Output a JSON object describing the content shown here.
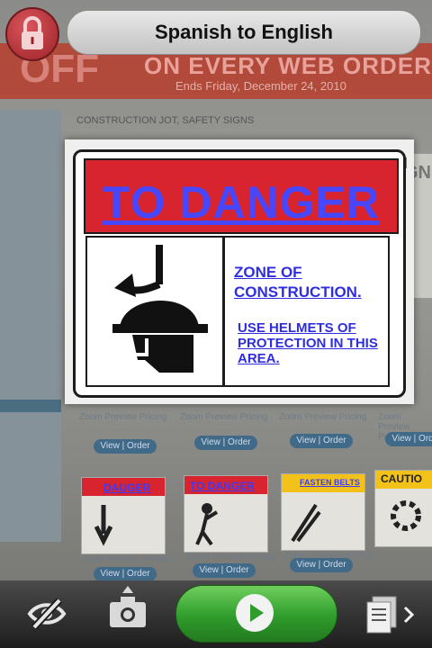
{
  "header": {
    "title": "Spanish to English",
    "lock_icon": "lock-icon"
  },
  "background": {
    "banner_off": "OFF",
    "banner_every": "ON EVERY WEB ORDER",
    "banner_sub": "Ends Friday, December 24, 2010",
    "breadcrumb": "CONSTRUCTION JOT, SAFETY SIGNS",
    "right_sign": "GNS",
    "thumb_link": "Zoom  Preview Pricing",
    "view_order": "View | Order"
  },
  "overlay": {
    "title": "TO DANGER",
    "line1": "ZONE OF CONSTRUCTION.",
    "line2": "USE HELMETS OF PROTECTION IN THIS AREA.",
    "close_label": "×"
  },
  "thumbnails": [
    {
      "header": "DAUGER",
      "color": "#d7242e",
      "overlay": "DAUGER"
    },
    {
      "header": "TO DANGER",
      "color": "#d7242e",
      "overlay": "TO DANGER"
    },
    {
      "header": "FASTEN BELTS",
      "color": "#f2c21a",
      "overlay": "FASTEN BELTS"
    },
    {
      "header": "CAUTIO",
      "color": "#f2c21a",
      "overlay": ""
    }
  ],
  "toolbar": {
    "hide_icon": "eye-slash-icon",
    "camera_icon": "camera-icon",
    "play_icon": "play-icon",
    "pages_icon": "pages-icon"
  },
  "colors": {
    "accent_green": "#2f9c2b",
    "danger_red": "#d7242e",
    "overlay_text": "#2e2ee0"
  }
}
